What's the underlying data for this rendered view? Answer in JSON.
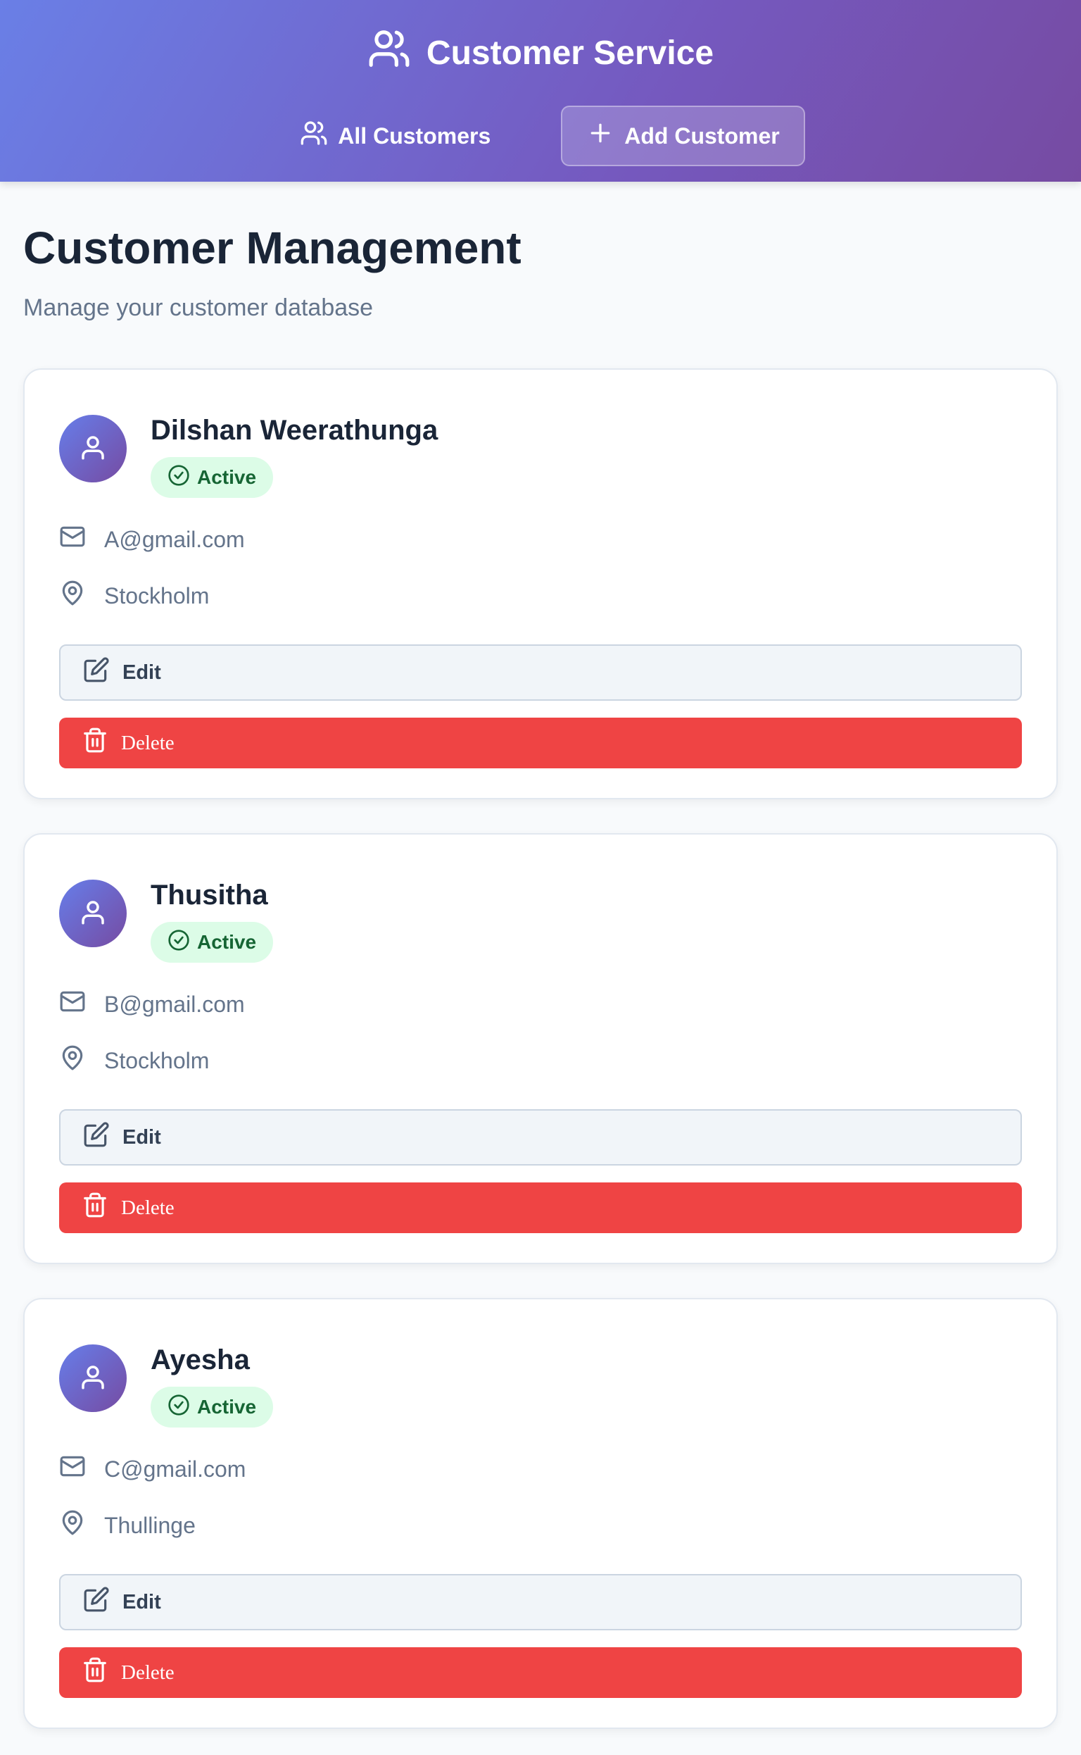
{
  "header": {
    "title": "Customer Service",
    "nav": [
      {
        "label": "All Customers",
        "icon": "users-icon",
        "active": false
      },
      {
        "label": "Add Customer",
        "icon": "plus-icon",
        "active": true
      }
    ]
  },
  "main": {
    "title": "Customer Management",
    "subtitle": "Manage your customer database"
  },
  "customers": [
    {
      "name": "Dilshan Weerathunga",
      "status": "Active",
      "email": "A@gmail.com",
      "location": "Stockholm",
      "edit_label": "Edit",
      "delete_label": "Delete"
    },
    {
      "name": "Thusitha",
      "status": "Active",
      "email": "B@gmail.com",
      "location": "Stockholm",
      "edit_label": "Edit",
      "delete_label": "Delete"
    },
    {
      "name": "Ayesha",
      "status": "Active",
      "email": "C@gmail.com",
      "location": "Thullinge",
      "edit_label": "Edit",
      "delete_label": "Delete"
    }
  ],
  "colors": {
    "brand_gradient_start": "#667eea",
    "brand_gradient_end": "#764ba2",
    "active_badge_bg": "#dcfce7",
    "active_badge_text": "#166534",
    "delete_button": "#ef4444"
  }
}
